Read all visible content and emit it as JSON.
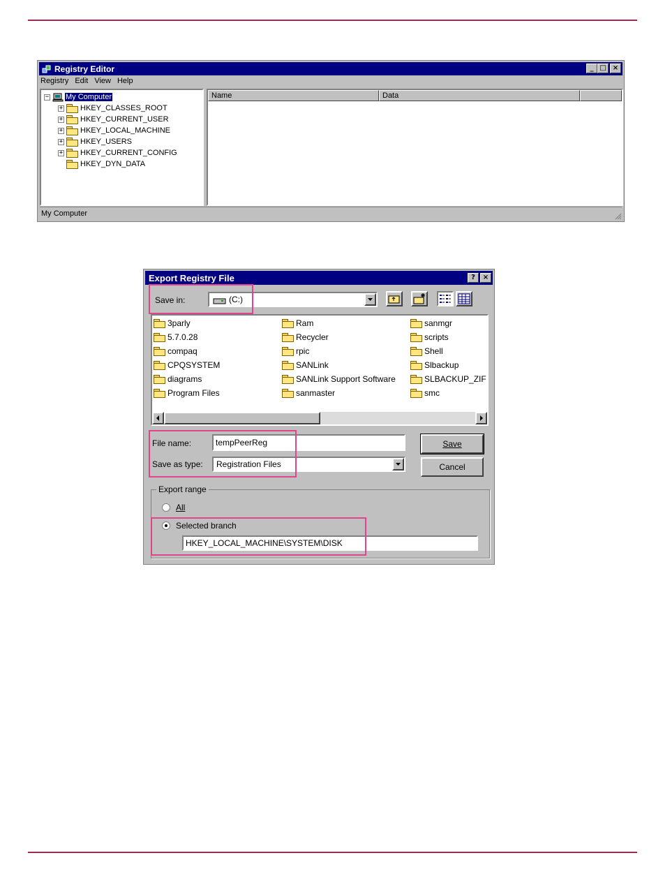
{
  "registry_editor": {
    "title": "Registry Editor",
    "menu": [
      "Registry",
      "Edit",
      "View",
      "Help"
    ],
    "tree_root": "My Computer",
    "tree_items": [
      {
        "label": "HKEY_CLASSES_ROOT",
        "expandable": true
      },
      {
        "label": "HKEY_CURRENT_USER",
        "expandable": true
      },
      {
        "label": "HKEY_LOCAL_MACHINE",
        "expandable": true
      },
      {
        "label": "HKEY_USERS",
        "expandable": true
      },
      {
        "label": "HKEY_CURRENT_CONFIG",
        "expandable": true
      },
      {
        "label": "HKEY_DYN_DATA",
        "expandable": false
      }
    ],
    "columns": [
      "Name",
      "Data"
    ],
    "status": "My Computer"
  },
  "export_dialog": {
    "title": "Export Registry File",
    "help_btn": "?",
    "close_btn": "×",
    "save_in_label": "Save in:",
    "save_in_value": "(C:)",
    "files": [
      [
        "3parly",
        "5.7.0.28",
        "compaq",
        "CPQSYSTEM",
        "diagrams",
        "Program Files"
      ],
      [
        "Ram",
        "Recycler",
        "rpic",
        "SANLink",
        "SANLink Support Software",
        "sanmaster"
      ],
      [
        "sanmgr",
        "scripts",
        "Shell",
        "Slbackup",
        "SLBACKUP_ZIF",
        "smc"
      ]
    ],
    "file_name_label": "File name:",
    "file_name_value": "tempPeerReg",
    "save_as_type_label": "Save as type:",
    "save_as_type_value": "Registration Files",
    "save_button": "Save",
    "cancel_button": "Cancel",
    "export_range_label": "Export range",
    "all_label": "All",
    "selected_branch_label": "Selected branch",
    "selected_branch_value": "HKEY_LOCAL_MACHINE\\SYSTEM\\DISK",
    "selected_range": "Selected branch",
    "highlight_color": "#e0448c"
  },
  "colors": {
    "rule": "#9b2a5b",
    "titlebar": "#000080",
    "face": "#c0c0c0"
  }
}
